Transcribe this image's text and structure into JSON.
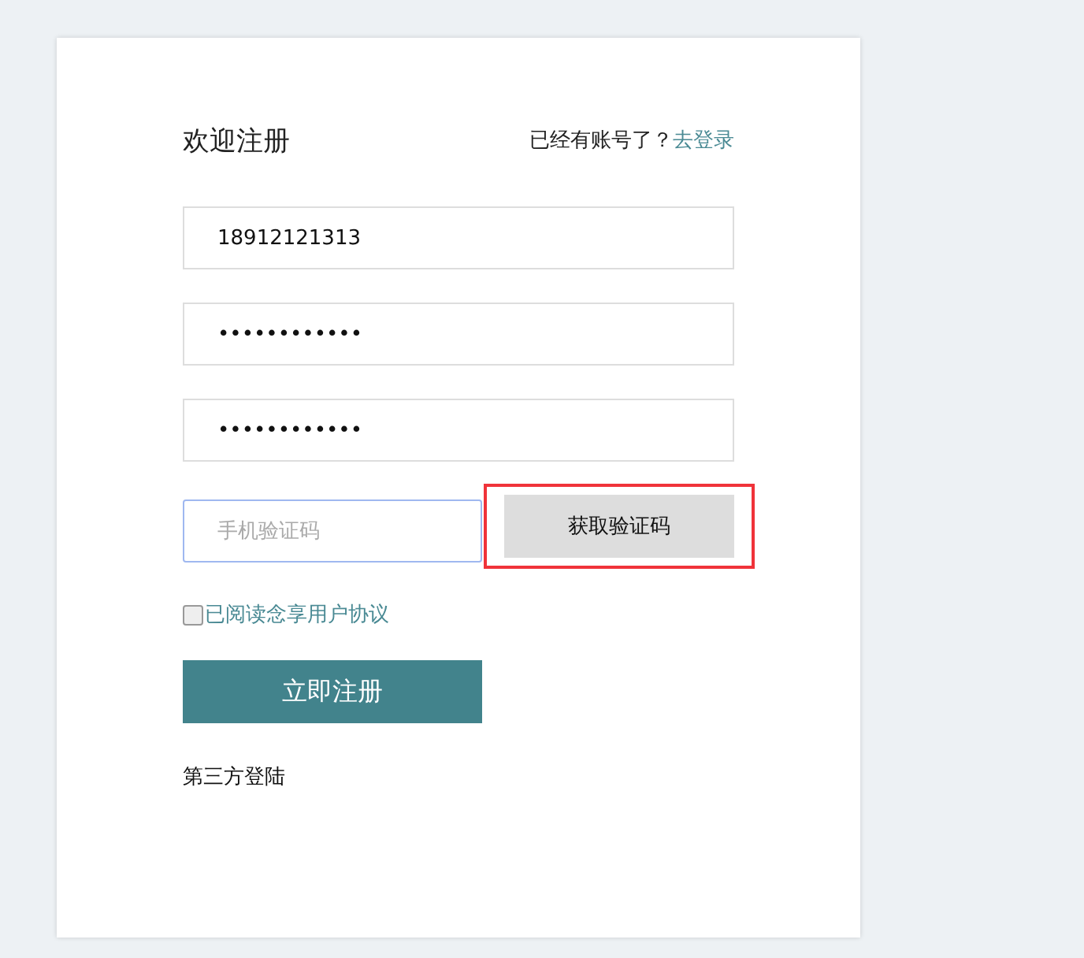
{
  "title": "欢迎注册",
  "login_prompt": {
    "text": "已经有账号了？",
    "link": "去登录"
  },
  "fields": [
    {
      "value": "18912121313"
    },
    {
      "value": "••••••••••••"
    },
    {
      "value": "••••••••••••"
    }
  ],
  "code_field": {
    "placeholder": "手机验证码",
    "focused": true
  },
  "code_button": {
    "label": "获取验证码",
    "highlighted": true
  },
  "agreement": {
    "checked": false,
    "label": "已阅读念享用户协议"
  },
  "submit": {
    "label": "立即注册"
  },
  "third_party": "第三方登陆"
}
